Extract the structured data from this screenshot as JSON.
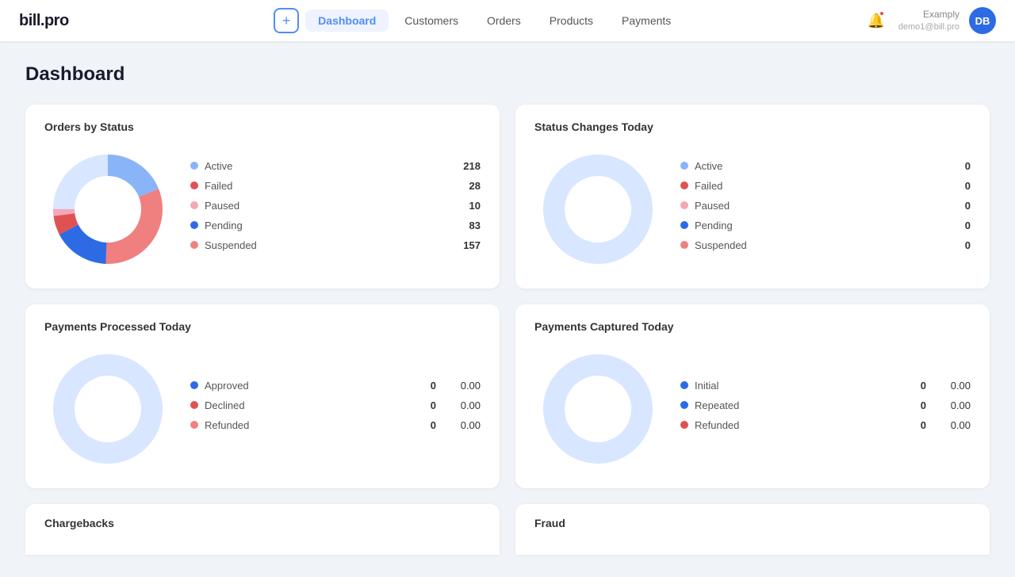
{
  "logo": {
    "text": "bill.pro"
  },
  "nav": {
    "add_button": "+",
    "items": [
      {
        "label": "Dashboard",
        "active": true
      },
      {
        "label": "Customers",
        "active": false
      },
      {
        "label": "Orders",
        "active": false
      },
      {
        "label": "Products",
        "active": false
      },
      {
        "label": "Payments",
        "active": false
      }
    ]
  },
  "user": {
    "name": "Examply",
    "email": "demo1@bill.pro",
    "initials": "DB"
  },
  "page": {
    "title": "Dashboard"
  },
  "cards": {
    "orders_by_status": {
      "title": "Orders by Status",
      "legend": [
        {
          "label": "Active",
          "color": "#8ab4f8",
          "value": "218"
        },
        {
          "label": "Failed",
          "color": "#e05252",
          "value": "28"
        },
        {
          "label": "Paused",
          "color": "#f4a7b9",
          "value": "10"
        },
        {
          "label": "Pending",
          "color": "#2d6be4",
          "value": "83"
        },
        {
          "label": "Suspended",
          "color": "#f08080",
          "value": "157"
        }
      ]
    },
    "status_changes": {
      "title": "Status Changes Today",
      "legend": [
        {
          "label": "Active",
          "color": "#8ab4f8",
          "value": "0"
        },
        {
          "label": "Failed",
          "color": "#e05252",
          "value": "0"
        },
        {
          "label": "Paused",
          "color": "#f4a7b9",
          "value": "0"
        },
        {
          "label": "Pending",
          "color": "#2d6be4",
          "value": "0"
        },
        {
          "label": "Suspended",
          "color": "#f08080",
          "value": "0"
        }
      ]
    },
    "payments_processed": {
      "title": "Payments Processed Today",
      "legend": [
        {
          "label": "Approved",
          "color": "#2d6be4",
          "value": "0",
          "amount": "0.00"
        },
        {
          "label": "Declined",
          "color": "#e05252",
          "value": "0",
          "amount": "0.00"
        },
        {
          "label": "Refunded",
          "color": "#f08080",
          "value": "0",
          "amount": "0.00"
        }
      ]
    },
    "payments_captured": {
      "title": "Payments Captured Today",
      "legend": [
        {
          "label": "Initial",
          "color": "#2d6be4",
          "value": "0",
          "amount": "0.00"
        },
        {
          "label": "Repeated",
          "color": "#2d6be4",
          "value": "0",
          "amount": "0.00"
        },
        {
          "label": "Refunded",
          "color": "#e05252",
          "value": "0",
          "amount": "0.00"
        }
      ]
    },
    "chargebacks": {
      "title": "Chargebacks"
    },
    "fraud": {
      "title": "Fraud"
    }
  }
}
